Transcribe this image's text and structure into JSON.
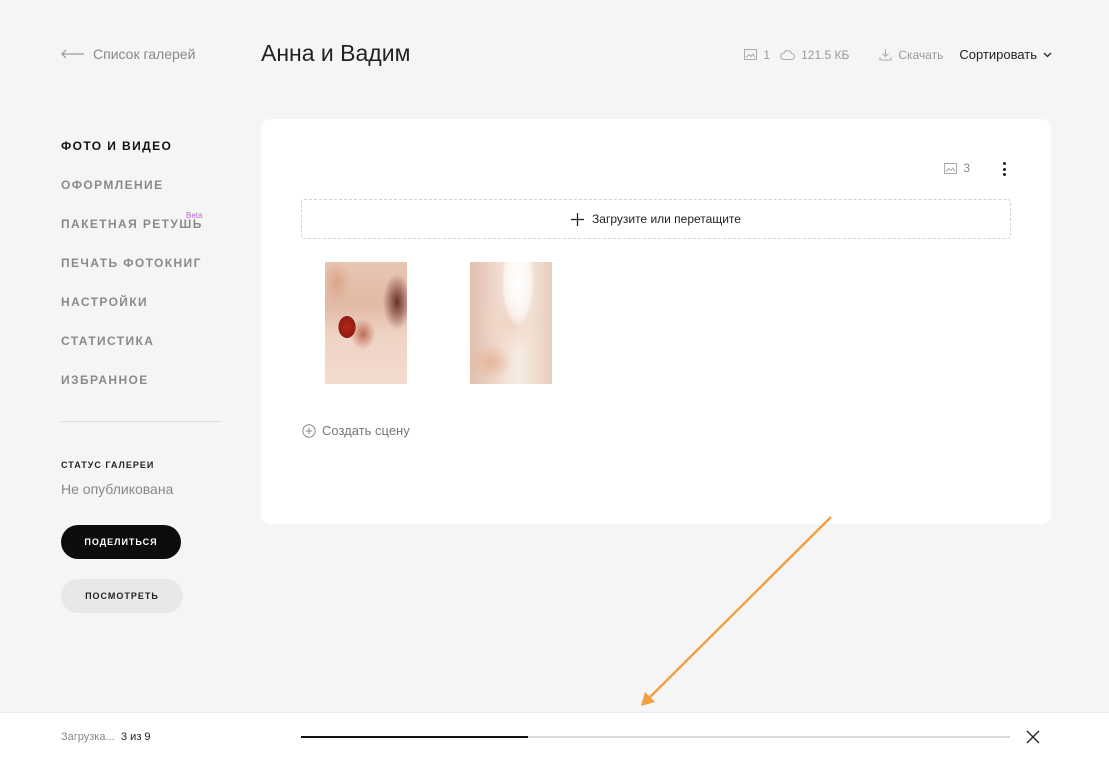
{
  "header": {
    "back_label": "Список галерей",
    "title": "Анна и Вадим",
    "photo_count": "1",
    "size": "121.5 КБ",
    "download_label": "Скачать",
    "sort_label": "Сортировать"
  },
  "sidebar": {
    "items": [
      {
        "label": "ФОТО И ВИДЕО",
        "active": true
      },
      {
        "label": "ОФОРМЛЕНИЕ"
      },
      {
        "label": "ПАКЕТНАЯ РЕТУШЬ",
        "badge": "Beta"
      },
      {
        "label": "ПЕЧАТЬ ФОТОКНИГ"
      },
      {
        "label": "НАСТРОЙКИ"
      },
      {
        "label": "СТАТИСТИКА"
      },
      {
        "label": "ИЗБРАННОЕ"
      }
    ],
    "status_label": "СТАТУС ГАЛЕРЕИ",
    "status_value": "Не опубликована",
    "share_button": "ПОДЕЛИТЬСЯ",
    "view_button": "ПОСМОТРЕТЬ"
  },
  "card": {
    "photo_count": "3",
    "dropzone_label": "Загрузите или перетащите",
    "create_scene_label": "Создать сцену"
  },
  "upload": {
    "status": "Загрузка...",
    "count": "3 из 9",
    "progress": 0.32
  },
  "colors": {
    "accent_arrow": "#f0a040",
    "beta_badge": "#b46bd6"
  }
}
